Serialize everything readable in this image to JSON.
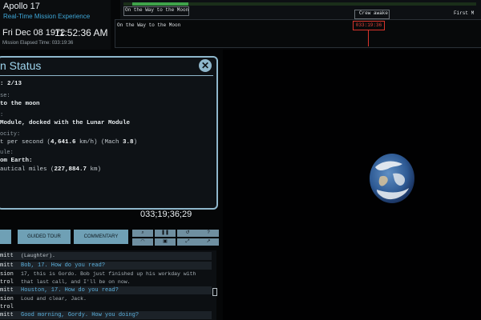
{
  "header": {
    "title": "Apollo 17",
    "subtitle": "Real-Time Mission Experience",
    "date": "Fri Dec 08 1972",
    "clock": "11:52:36 AM",
    "elapsed": "Mission Elapsed Time: 033:19:36"
  },
  "timeline": {
    "label_left": "On the Way to the Moon",
    "label_mid": "Crew awake",
    "label_right": "First M",
    "lane_label": "On the Way to the Moon",
    "marker": "033:19:36"
  },
  "status": {
    "title": "n Status",
    "close": "✕",
    "line1": ": 2/13",
    "line2": "se:",
    "line3": "to the moon",
    "line4": ":",
    "line5": "Module, docked with the Lunar Module",
    "line6": "ocity:",
    "line7a": "t per second (",
    "line7b": "4,641.6",
    "line7c": " km/h) (Mach ",
    "line7d": "3.8",
    "line7e": ")",
    "line8": "ule:",
    "line9": "om Earth:",
    "line10a": "autical miles (",
    "line10b": "227,884.7",
    "line10c": " km)",
    "met": "033;19;36;29"
  },
  "controls": {
    "guided_tour": "GUIDED TOUR",
    "commentary": "COMMENTARY"
  },
  "transcript": {
    "r1_who": "mitt",
    "r1_text": "(Laughter).",
    "r2_who": "mitt",
    "r2_text": "Bob, 17. How do you read?",
    "r3_who": "sion",
    "r3_text": "17, this is Gordo. Bob just finished up his workday with",
    "r3_who2": "trol",
    "r3_text2": "that last call, and I'll be on now.",
    "r4_who": "mitt",
    "r4_text": "Houston, 17. How do you read?",
    "r5_who": "sion",
    "r5_text": "Loud and clear, Jack.",
    "r5_who2": "trol",
    "r6_who": "mitt",
    "r6_text": "Good morning, Gordy. How you doing?"
  }
}
